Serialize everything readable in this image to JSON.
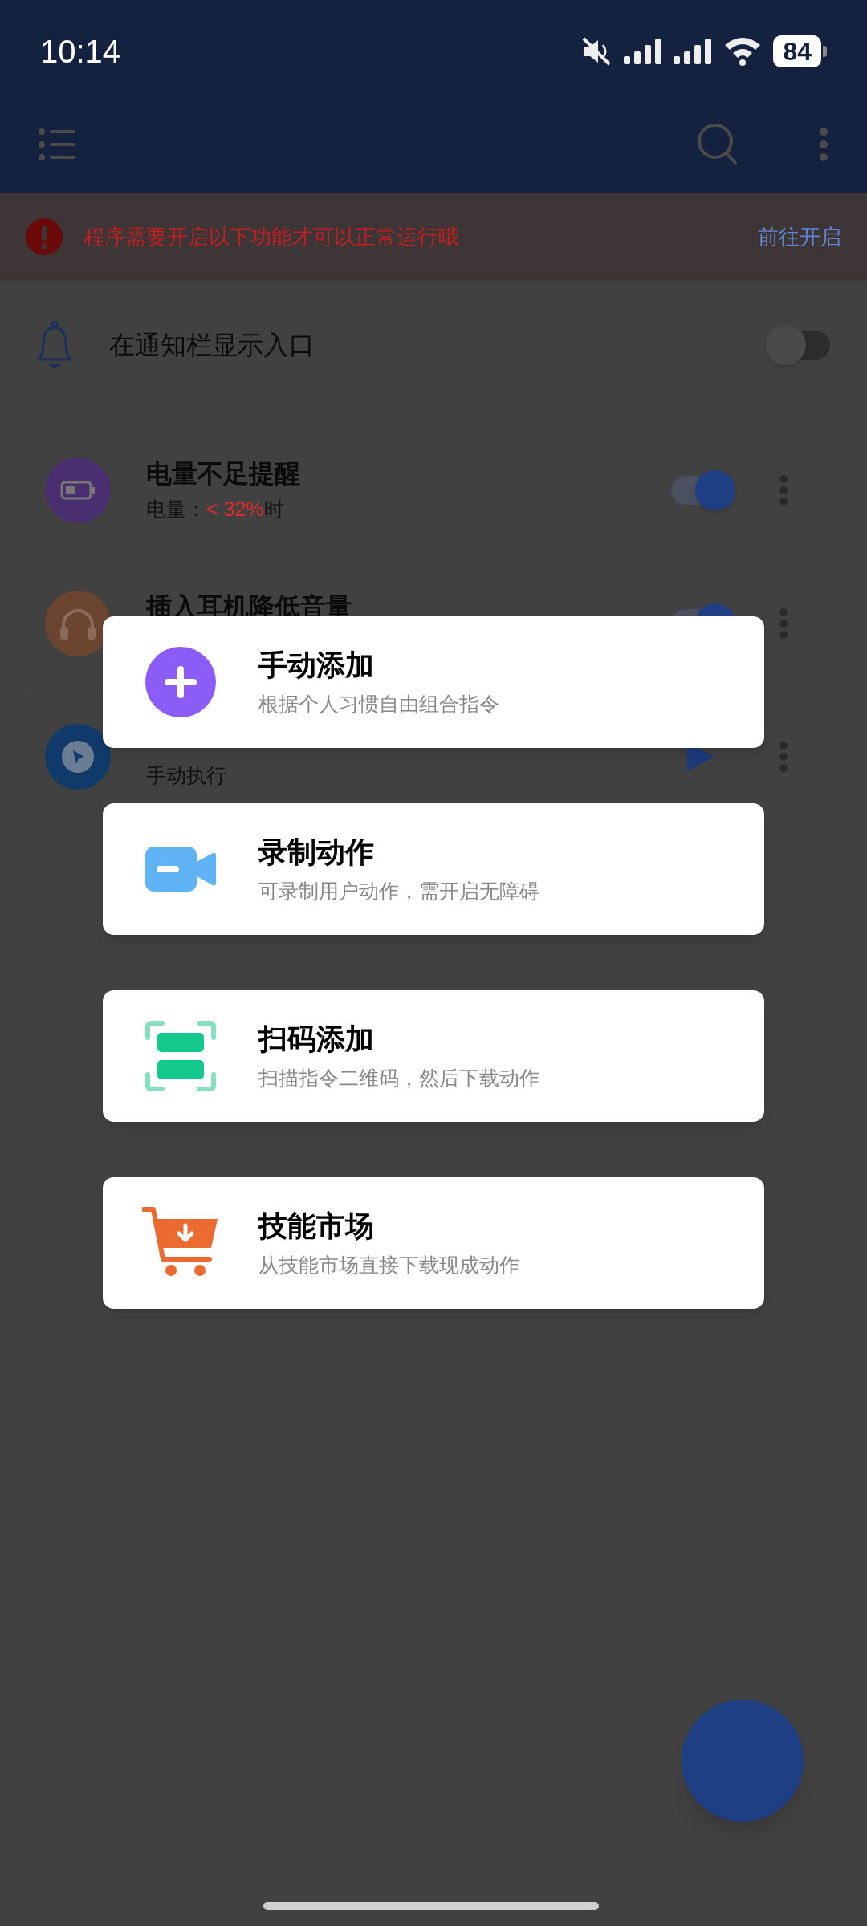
{
  "status_bar": {
    "time": "10:14",
    "battery": "84"
  },
  "banner": {
    "message": "程序需要开启以下功能才可以正常运行哦",
    "action": "前往开启"
  },
  "notification_entry": {
    "label": "在通知栏显示入口",
    "on": false
  },
  "tasks": [
    {
      "kind": "toggle",
      "color": "#4a2f70",
      "title": "电量不足提醒",
      "subtitle": [
        {
          "text": "电量：",
          "highlight": false
        },
        {
          "text": "< 32%",
          "highlight": true
        },
        {
          "text": "时",
          "highlight": false
        }
      ],
      "on": true
    },
    {
      "kind": "toggle",
      "color": "#6b4530",
      "title": "插入耳机降低音量",
      "on": true
    },
    {
      "kind": "run",
      "color": "#103a6a",
      "subtitle": [
        {
          "text": "手动执行",
          "highlight": false
        }
      ]
    }
  ],
  "add_menu": [
    {
      "title": "手动添加",
      "description": "根据个人习惯自由组合指令"
    },
    {
      "title": "录制动作",
      "description": "可录制用户动作，需开启无障碍"
    },
    {
      "title": "扫码添加",
      "description": "扫描指令二维码，然后下载动作"
    },
    {
      "title": "技能市场",
      "description": "从技能市场直接下载现成动作"
    }
  ]
}
